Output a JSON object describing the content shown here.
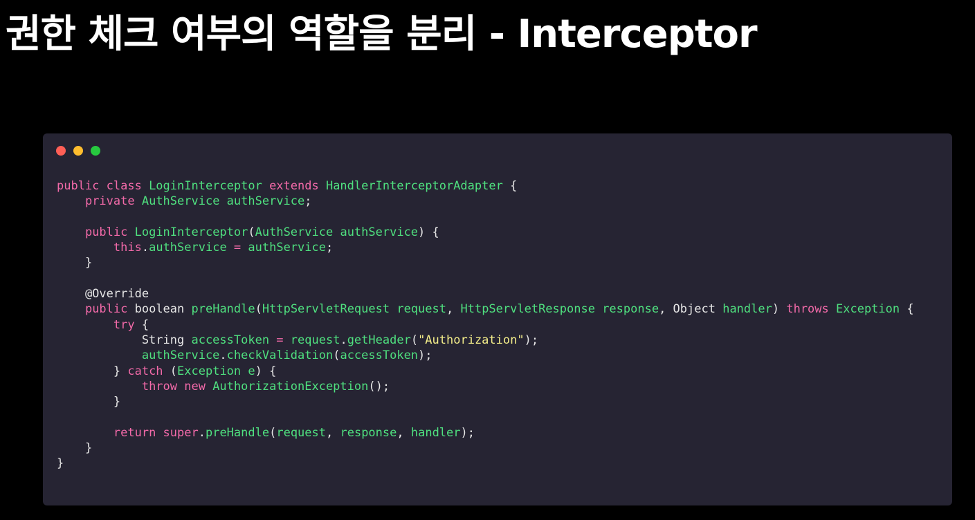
{
  "title": "권한 체크 여부의 역할을 분리 - Interceptor",
  "colors": {
    "background": "#000000",
    "window": "#262433",
    "keyword": "#f36aa9",
    "identifier": "#4fe07f",
    "plain": "#e6e6e6",
    "string": "#f4ee8a"
  },
  "window_controls": [
    {
      "name": "close",
      "color": "#ff5f56"
    },
    {
      "name": "minimize",
      "color": "#ffbd2e"
    },
    {
      "name": "maximize",
      "color": "#27c93f"
    }
  ],
  "code_lines": [
    [
      [
        "kw",
        "public class "
      ],
      [
        "ty",
        "LoginInterceptor "
      ],
      [
        "kw",
        "extends "
      ],
      [
        "ty",
        "HandlerInterceptorAdapter "
      ],
      [
        "pl",
        "{"
      ]
    ],
    [
      [
        "pl",
        "    "
      ],
      [
        "kw",
        "private "
      ],
      [
        "ty",
        "AuthService "
      ],
      [
        "id",
        "authService"
      ],
      [
        "pl",
        ";"
      ]
    ],
    [],
    [
      [
        "pl",
        "    "
      ],
      [
        "kw",
        "public "
      ],
      [
        "ty",
        "LoginInterceptor"
      ],
      [
        "pl",
        "("
      ],
      [
        "ty",
        "AuthService "
      ],
      [
        "id",
        "authService"
      ],
      [
        "pl",
        ") {"
      ]
    ],
    [
      [
        "pl",
        "        "
      ],
      [
        "kw",
        "this"
      ],
      [
        "pl",
        "."
      ],
      [
        "id",
        "authService "
      ],
      [
        "kw",
        "= "
      ],
      [
        "id",
        "authService"
      ],
      [
        "pl",
        ";"
      ]
    ],
    [
      [
        "pl",
        "    }"
      ]
    ],
    [],
    [
      [
        "pl",
        "    @Override"
      ]
    ],
    [
      [
        "pl",
        "    "
      ],
      [
        "kw",
        "public "
      ],
      [
        "pl",
        "boolean "
      ],
      [
        "id",
        "preHandle"
      ],
      [
        "pl",
        "("
      ],
      [
        "ty",
        "HttpServletRequest "
      ],
      [
        "id",
        "request"
      ],
      [
        "pl",
        ", "
      ],
      [
        "ty",
        "HttpServletResponse "
      ],
      [
        "id",
        "response"
      ],
      [
        "pl",
        ", Object "
      ],
      [
        "id",
        "handler"
      ],
      [
        "pl",
        ") "
      ],
      [
        "kw",
        "throws "
      ],
      [
        "ty",
        "Exception "
      ],
      [
        "pl",
        "{"
      ]
    ],
    [
      [
        "pl",
        "        "
      ],
      [
        "kw",
        "try "
      ],
      [
        "pl",
        "{"
      ]
    ],
    [
      [
        "pl",
        "            String "
      ],
      [
        "id",
        "accessToken "
      ],
      [
        "kw",
        "= "
      ],
      [
        "id",
        "request"
      ],
      [
        "pl",
        "."
      ],
      [
        "id",
        "getHeader"
      ],
      [
        "pl",
        "("
      ],
      [
        "str",
        "\"Authorization\""
      ],
      [
        "pl",
        ");"
      ]
    ],
    [
      [
        "pl",
        "            "
      ],
      [
        "id",
        "authService"
      ],
      [
        "pl",
        "."
      ],
      [
        "id",
        "checkValidation"
      ],
      [
        "pl",
        "("
      ],
      [
        "id",
        "accessToken"
      ],
      [
        "pl",
        ");"
      ]
    ],
    [
      [
        "pl",
        "        } "
      ],
      [
        "kw",
        "catch "
      ],
      [
        "pl",
        "("
      ],
      [
        "ty",
        "Exception "
      ],
      [
        "id",
        "e"
      ],
      [
        "pl",
        ") {"
      ]
    ],
    [
      [
        "pl",
        "            "
      ],
      [
        "kw",
        "throw new "
      ],
      [
        "ty",
        "AuthorizationException"
      ],
      [
        "pl",
        "();"
      ]
    ],
    [
      [
        "pl",
        "        }"
      ]
    ],
    [],
    [
      [
        "pl",
        "        "
      ],
      [
        "kw",
        "return super"
      ],
      [
        "pl",
        "."
      ],
      [
        "id",
        "preHandle"
      ],
      [
        "pl",
        "("
      ],
      [
        "id",
        "request"
      ],
      [
        "pl",
        ", "
      ],
      [
        "id",
        "response"
      ],
      [
        "pl",
        ", "
      ],
      [
        "id",
        "handler"
      ],
      [
        "pl",
        ");"
      ]
    ],
    [
      [
        "pl",
        "    }"
      ]
    ],
    [
      [
        "pl",
        "}"
      ]
    ]
  ]
}
